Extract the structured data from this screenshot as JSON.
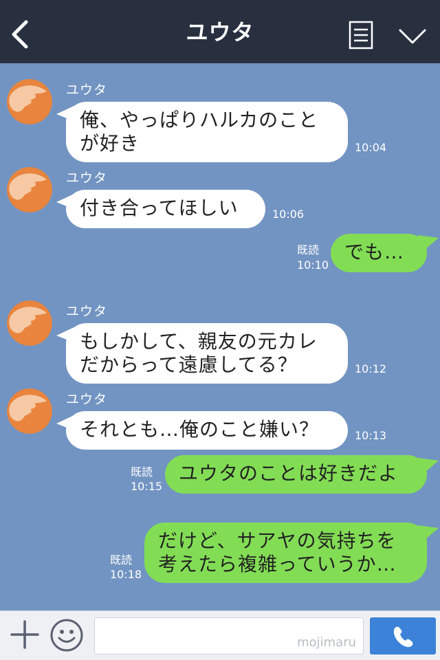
{
  "header": {
    "title": "ユウタ",
    "back_icon": "chevron-left-icon",
    "menu_icon": "list-icon",
    "collapse_icon": "chevron-down-icon"
  },
  "messages": [
    {
      "side": "left",
      "sender": "ユウタ",
      "text": "俺、やっぱりハルカのこと\nが好き",
      "time": "10:04"
    },
    {
      "side": "left",
      "sender": "ユウタ",
      "text": "付き合ってほしい",
      "time": "10:06"
    },
    {
      "side": "right",
      "read": "既読",
      "text": "でも…",
      "time": "10:10"
    },
    {
      "side": "left",
      "sender": "ユウタ",
      "text": "もしかして、親友の元カレ\nだからって遠慮してる？",
      "time": "10:12"
    },
    {
      "side": "left",
      "sender": "ユウタ",
      "text": "それとも…俺のこと嫌い？",
      "time": "10:13"
    },
    {
      "side": "right",
      "read": "既読",
      "text": "ユウタのことは好きだよ",
      "time": "10:15"
    },
    {
      "side": "right",
      "read": "既読",
      "text": "だけど、サアヤの気持ちを\n考えたら複雑っていうか…",
      "time": "10:18"
    }
  ],
  "footer": {
    "add_icon": "plus-icon",
    "emoji_icon": "smiley-icon",
    "input_value": "",
    "watermark": "mojimaru",
    "call_icon": "phone-icon"
  },
  "colors": {
    "header_bg": "#283040",
    "chat_bg": "#7294c2",
    "own_bubble": "#82dd55",
    "other_bubble": "#ffffff",
    "call_button": "#3b82d8"
  }
}
